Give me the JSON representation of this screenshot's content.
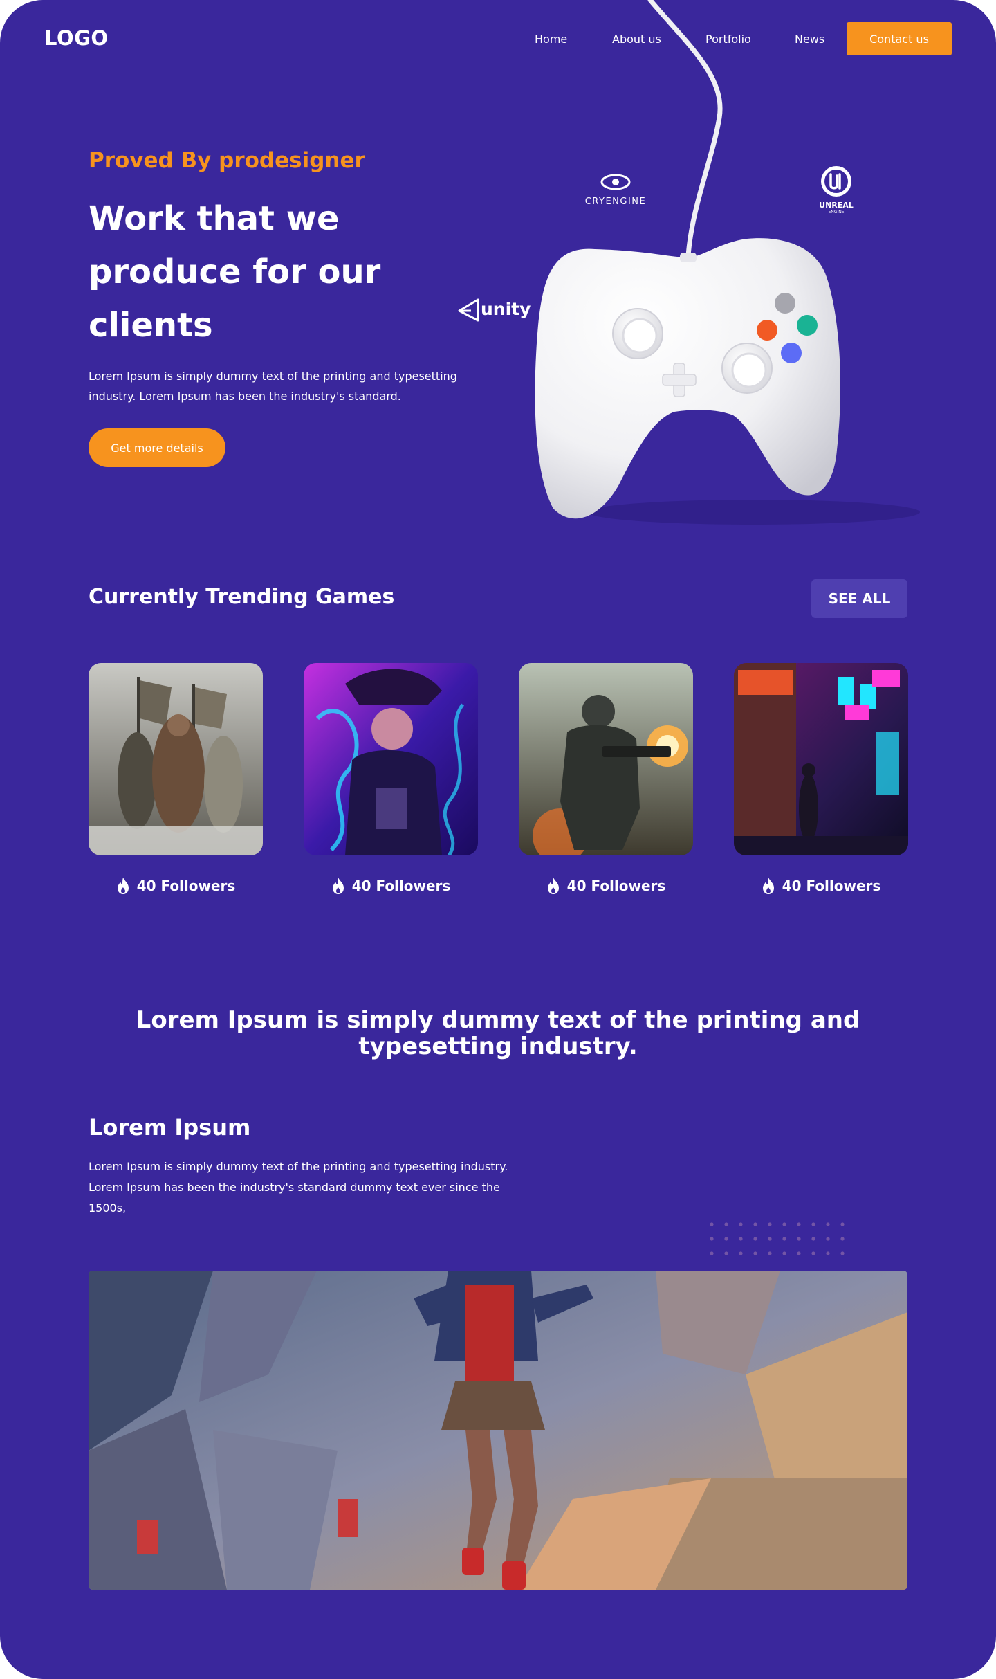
{
  "header": {
    "logo": "LOGO",
    "nav": {
      "home": "Home",
      "about": "About us",
      "portfolio": "Portfolio",
      "news": "News"
    },
    "contact_label": "Contact us"
  },
  "hero": {
    "eyebrow": "Proved By prodesigner",
    "title_lines": [
      "Work that we",
      "produce for our",
      "clients"
    ],
    "description": "Lorem Ipsum is simply dummy text of the printing and typesetting industry. Lorem Ipsum has been the industry's standard.",
    "cta_label": "Get more details",
    "engines": {
      "cryengine": "CRYENGINE",
      "unreal": "UNREAL",
      "unreal_sub": "ENGINE",
      "unity": "unity"
    }
  },
  "trending": {
    "title": "Currently Trending Games",
    "see_all_label": "SEE ALL",
    "games": [
      {
        "followers": "40 Followers"
      },
      {
        "followers": "40 Followers"
      },
      {
        "followers": "40 Followers"
      },
      {
        "followers": "40 Followers"
      }
    ]
  },
  "tagline": "Lorem Ipsum is simply dummy text of the printing and typesetting industry.",
  "about": {
    "title": "Lorem Ipsum",
    "description": "Lorem Ipsum is simply dummy text of the printing and typesetting industry. Lorem Ipsum has been the industry's standard dummy text ever since the 1500s,"
  },
  "colors": {
    "background": "#3a279c",
    "accent": "#f7931e",
    "secondary_button": "#4f3fb0"
  },
  "icons": [
    "flame-icon",
    "cryengine-logo",
    "unreal-logo",
    "unity-logo"
  ]
}
